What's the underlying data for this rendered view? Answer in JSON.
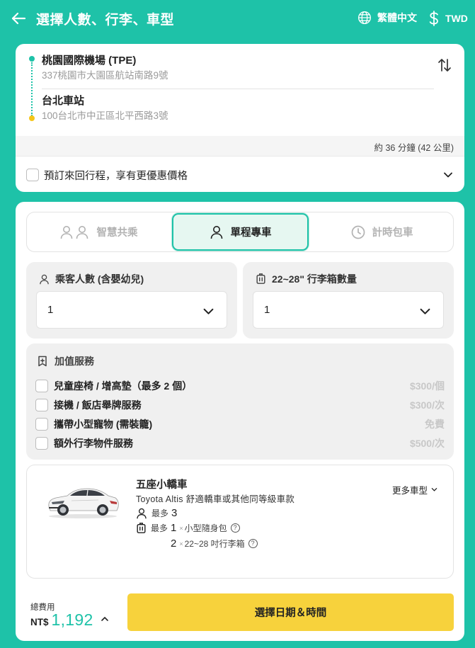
{
  "header": {
    "title": "選擇人數、行李、車型",
    "language": "繁體中文",
    "currency": "TWD"
  },
  "route": {
    "origin": {
      "name": "桃園國際機場 (TPE)",
      "address": "337桃園市大園區航站南路9號"
    },
    "destination": {
      "name": "台北車站",
      "address": "100台北市中正區北平西路3號"
    },
    "duration": "約 36 分鐘 (42 公里)",
    "round_trip_label": "預訂來回行程，享有更優惠價格"
  },
  "tabs": [
    {
      "label": "智慧共乘",
      "selected": false
    },
    {
      "label": "單程專車",
      "selected": true
    },
    {
      "label": "計時包車",
      "selected": false
    }
  ],
  "passengers": {
    "label": "乘客人數 (含嬰幼兒)",
    "value": "1"
  },
  "luggage": {
    "label": "22~28\" 行李箱數量",
    "value": "1"
  },
  "addons": {
    "title": "加值服務",
    "items": [
      {
        "label": "兒童座椅 / 增高墊（最多 2 個）",
        "price": "$300/個"
      },
      {
        "label": "接機 / 飯店舉牌服務",
        "price": "$300/次"
      },
      {
        "label": "攜帶小型寵物 (需裝籠)",
        "price": "免費"
      },
      {
        "label": "額外行李物件服務",
        "price": "$500/次"
      }
    ]
  },
  "vehicle": {
    "name": "五座小轎車",
    "description": "Toyota Altis 舒適轎車或其他同等級車款",
    "more_label": "更多車型",
    "max_label": "最多",
    "passengers_max": "3",
    "bags_small_count": "1",
    "bags_small_label": "小型隨身包",
    "bags_large_count": "2",
    "bags_large_label": "22~28 吋行李箱",
    "times": "×"
  },
  "footer": {
    "total_label": "總費用",
    "currency_code": "NT$",
    "amount": "1,192",
    "cta_label": "選擇日期＆時間"
  },
  "colors": {
    "primary": "#1ec2a8",
    "accent": "#f7d23c",
    "dot_end": "#f5c518"
  }
}
